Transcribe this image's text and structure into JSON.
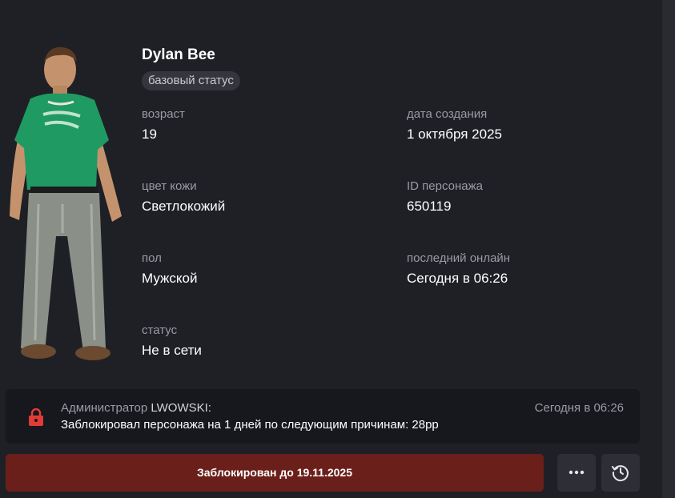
{
  "profile": {
    "name": "Dylan Bee",
    "status_badge": "базовый статус"
  },
  "fields": {
    "age": {
      "label": "возраст",
      "value": "19"
    },
    "created": {
      "label": "дата создания",
      "value": "1 октября 2025"
    },
    "skin": {
      "label": "цвет кожи",
      "value": "Светлокожий"
    },
    "char_id": {
      "label": "ID персонажа",
      "value": "650119"
    },
    "gender": {
      "label": "пол",
      "value": "Мужской"
    },
    "last_online": {
      "label": "последний онлайн",
      "value": "Сегодня в 06:26"
    },
    "status": {
      "label": "статус",
      "value": "Не в сети"
    }
  },
  "log": {
    "role": "Администратор",
    "admin_name": "LWOWSKI:",
    "message": "Заблокировал персонажа на 1 дней по следующим причинам: 28рр",
    "time": "Сегодня в 06:26",
    "icon": "lock-icon"
  },
  "actions": {
    "ban_label": "Заблокирован до 19.11.2025",
    "more_icon": "more-dots-icon",
    "history_icon": "history-icon"
  },
  "colors": {
    "background": "#1f2026",
    "ban_button": "#6b1f1b",
    "lock_red": "#e23b35",
    "shirt_green": "#1f9a62"
  }
}
